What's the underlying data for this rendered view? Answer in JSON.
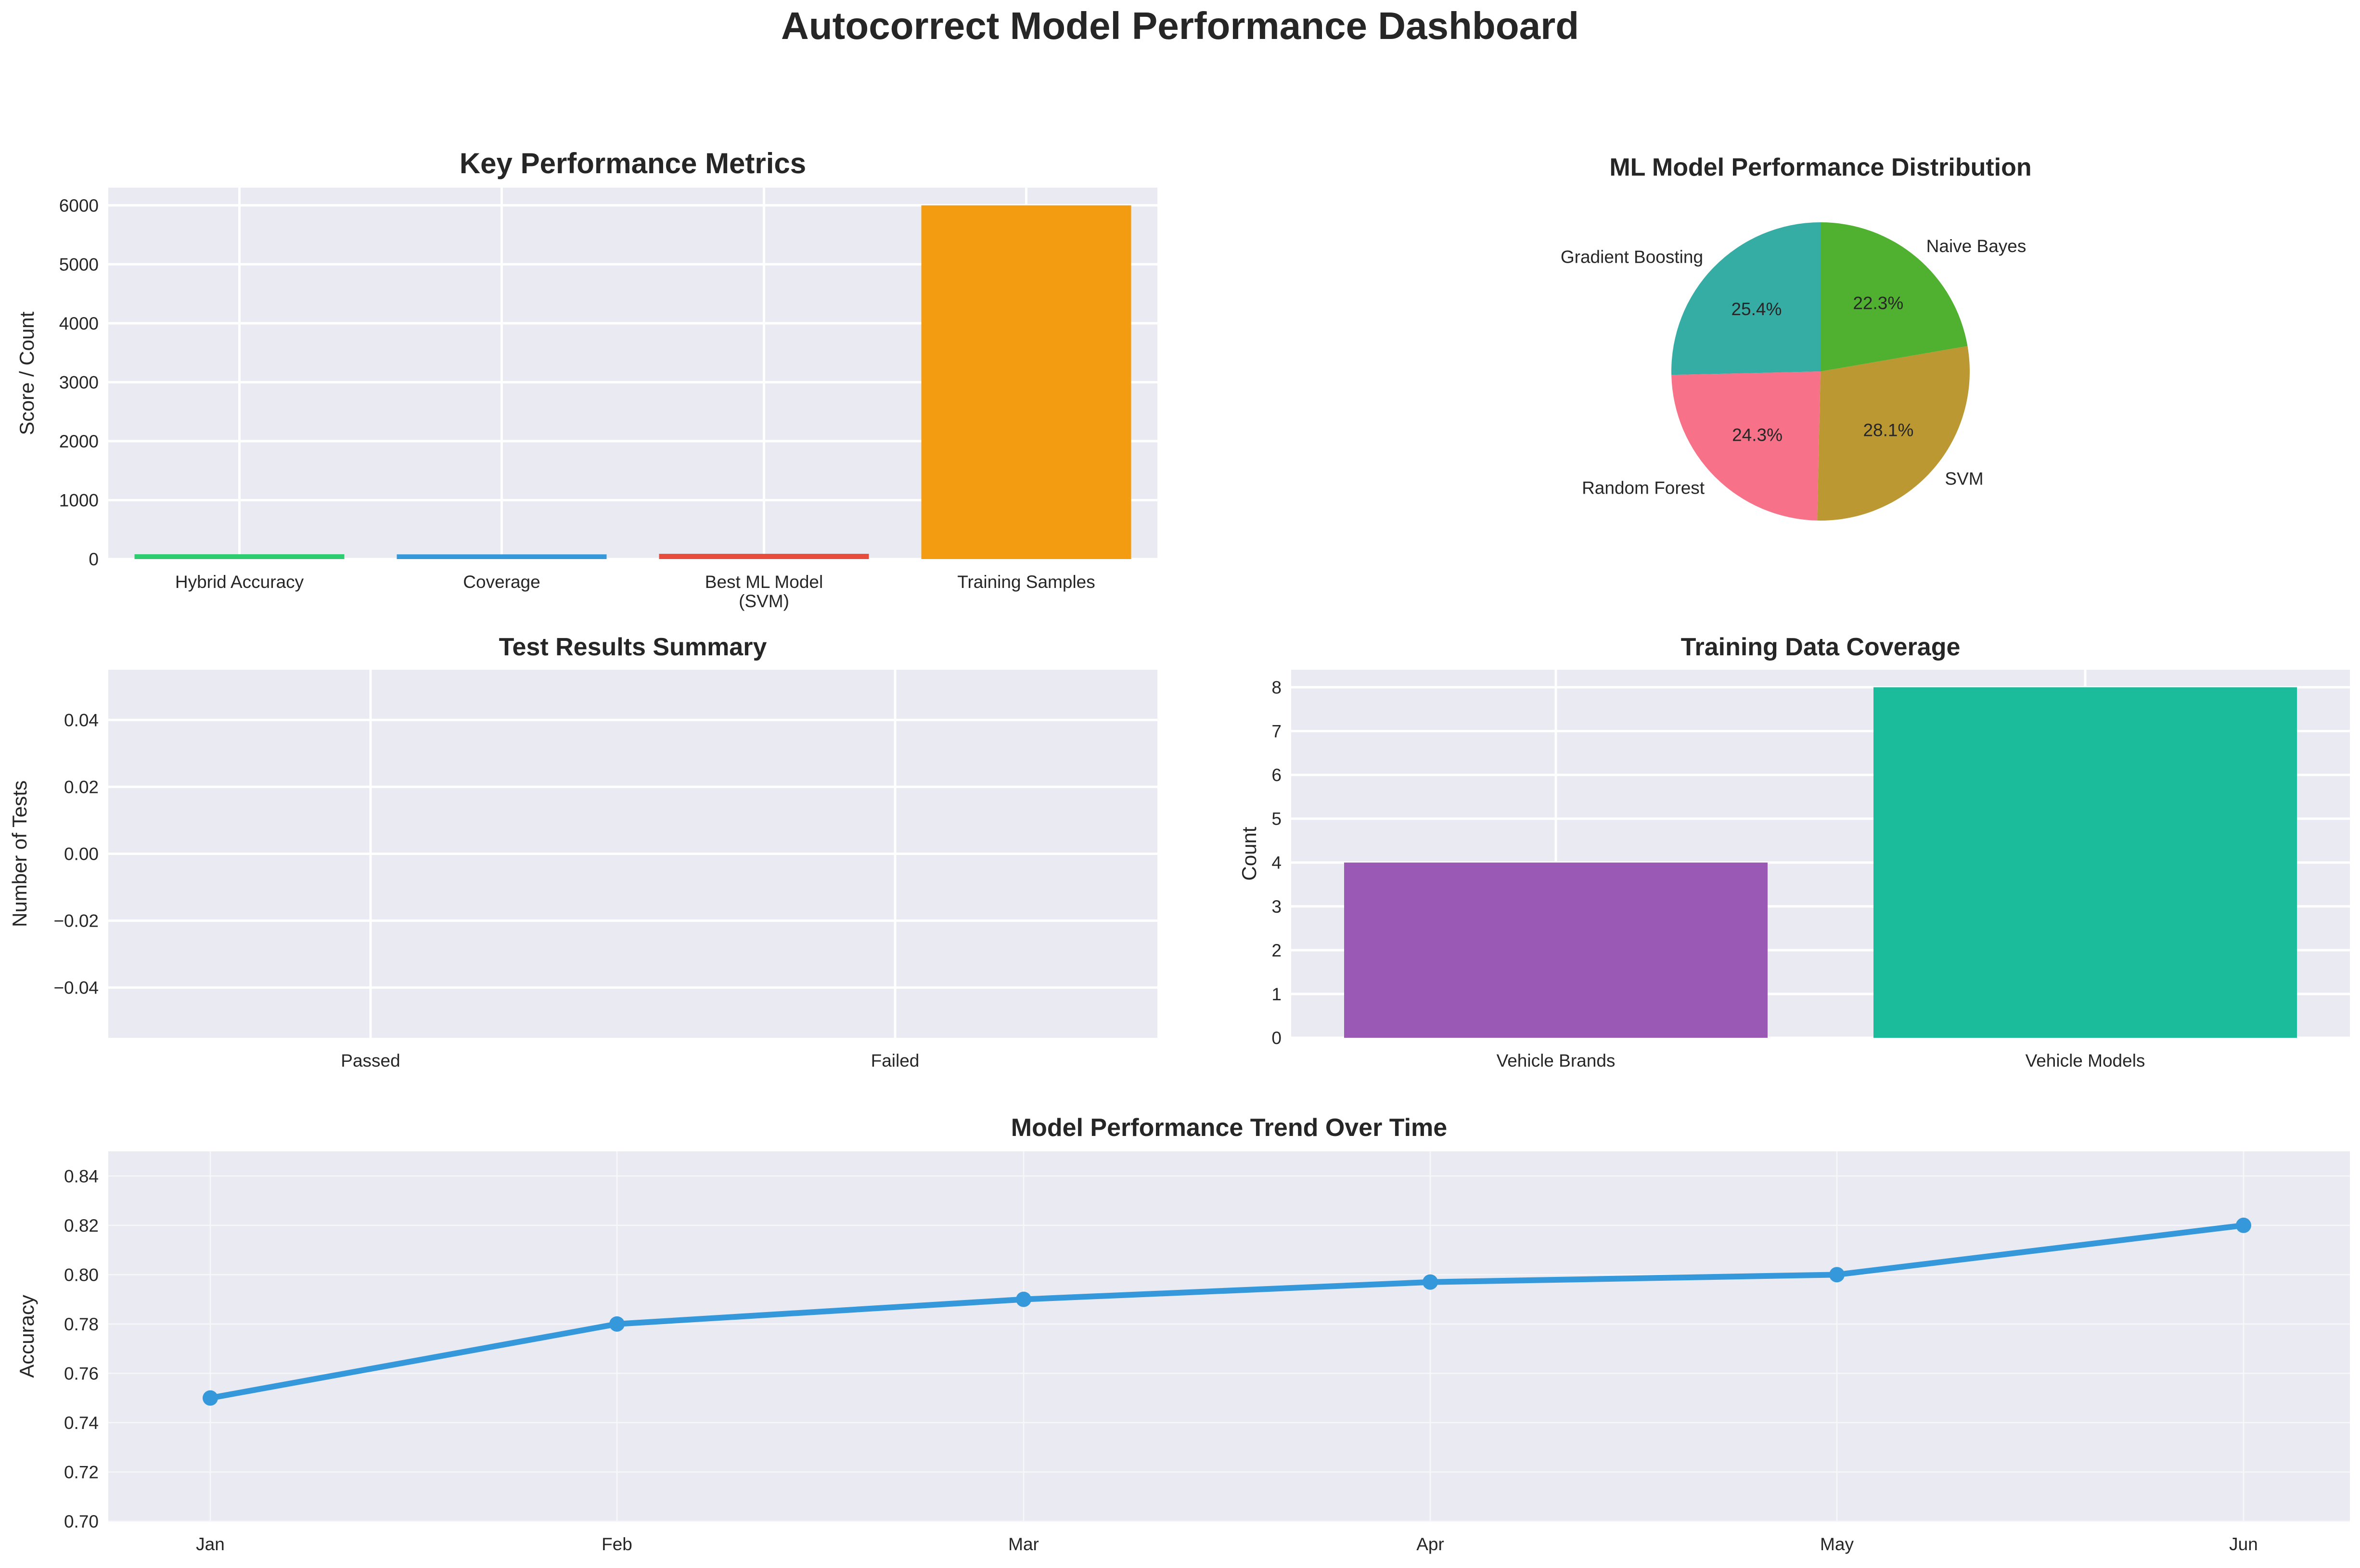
{
  "title": "Autocorrect Model Performance Dashboard",
  "chart_data": [
    {
      "id": "key_metrics",
      "type": "bar",
      "title": "Key Performance Metrics",
      "xlabel": "",
      "ylabel": "Score / Count",
      "categories": [
        "Hybrid Accuracy",
        "Coverage",
        "Best ML Model\n(SVM)",
        "Training Samples"
      ],
      "values": [
        82,
        80,
        89,
        6000
      ],
      "colors": [
        "#2ecc71",
        "#3498db",
        "#e74c3c",
        "#f39c12"
      ],
      "ylim": [
        0,
        6300
      ],
      "yticks": [
        0,
        1000,
        2000,
        3000,
        4000,
        5000,
        6000
      ],
      "grid": true
    },
    {
      "id": "ml_distribution",
      "type": "pie",
      "title": "ML Model Performance Distribution",
      "labels": [
        "Gradient Boosting",
        "Random Forest",
        "SVM",
        "Naive Bayes"
      ],
      "values": [
        25.4,
        24.3,
        28.1,
        22.3
      ],
      "pct_labels": [
        "25.4%",
        "24.3%",
        "28.1%",
        "22.3%"
      ],
      "colors": [
        "#36ada4",
        "#f77189",
        "#bb9832",
        "#50b131"
      ]
    },
    {
      "id": "test_results",
      "type": "bar",
      "title": "Test Results Summary",
      "xlabel": "",
      "ylabel": "Number of Tests",
      "categories": [
        "Passed",
        "Failed"
      ],
      "values": [
        0,
        0
      ],
      "ylim": [
        -0.055,
        0.055
      ],
      "yticks": [
        -0.04,
        -0.02,
        0.0,
        0.02,
        0.04
      ],
      "ytick_labels": [
        "−0.04",
        "−0.02",
        "0.00",
        "0.02",
        "0.04"
      ],
      "grid": true
    },
    {
      "id": "data_coverage",
      "type": "bar",
      "title": "Training Data Coverage",
      "xlabel": "",
      "ylabel": "Count",
      "categories": [
        "Vehicle Brands",
        "Vehicle Models"
      ],
      "values": [
        4,
        8
      ],
      "colors": [
        "#9b59b6",
        "#1abc9c"
      ],
      "ylim": [
        0,
        8.4
      ],
      "yticks": [
        0,
        1,
        2,
        3,
        4,
        5,
        6,
        7,
        8
      ],
      "grid": true
    },
    {
      "id": "trend",
      "type": "line",
      "title": "Model Performance Trend Over Time",
      "xlabel": "",
      "ylabel": "Accuracy",
      "x": [
        "Jan",
        "Feb",
        "Mar",
        "Apr",
        "May",
        "Jun"
      ],
      "values": [
        0.75,
        0.78,
        0.79,
        0.797,
        0.8,
        0.82
      ],
      "color": "#3498db",
      "ylim": [
        0.7,
        0.85
      ],
      "yticks": [
        0.7,
        0.72,
        0.74,
        0.76,
        0.78,
        0.8,
        0.82,
        0.84
      ],
      "ytick_labels": [
        "0.70",
        "0.72",
        "0.74",
        "0.76",
        "0.78",
        "0.80",
        "0.82",
        "0.84"
      ],
      "grid": true
    }
  ]
}
